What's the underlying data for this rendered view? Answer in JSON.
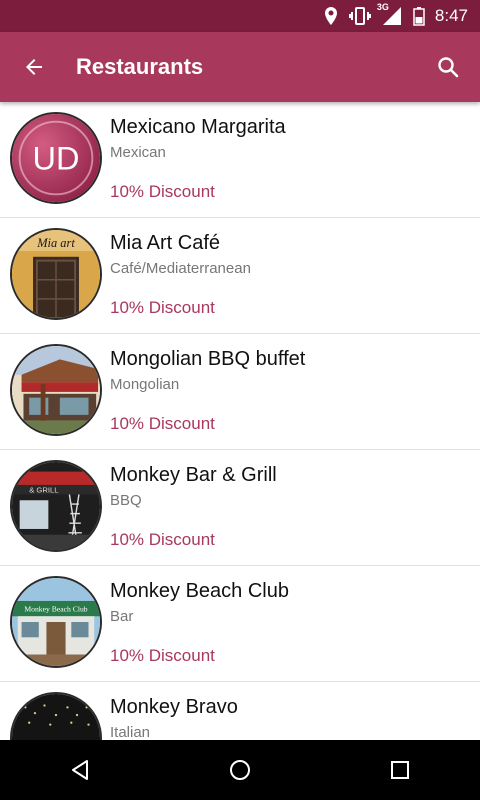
{
  "status": {
    "time": "8:47",
    "network": "3G"
  },
  "appbar": {
    "title": "Restaurants"
  },
  "restaurants": [
    {
      "name": "Mexicano Margarita",
      "cuisine": "Mexican",
      "discount": "10% Discount",
      "logo_text": "UD"
    },
    {
      "name": "Mia Art Café",
      "cuisine": "Café/Mediaterranean",
      "discount": "10% Discount",
      "logo_text": "Mia art"
    },
    {
      "name": "Mongolian BBQ buffet",
      "cuisine": "Mongolian",
      "discount": "10% Discount"
    },
    {
      "name": "Monkey Bar & Grill",
      "cuisine": "BBQ",
      "discount": "10% Discount",
      "logo_text": "& GRILL"
    },
    {
      "name": "Monkey Beach Club",
      "cuisine": "Bar",
      "discount": "10% Discount",
      "logo_text": "Monkey Beach Club"
    },
    {
      "name": "Monkey Bravo",
      "cuisine": "Italian",
      "discount": ""
    }
  ],
  "colors": {
    "statusbar": "#7d1d3e",
    "appbar": "#a8385c",
    "discount": "#a8385c"
  }
}
